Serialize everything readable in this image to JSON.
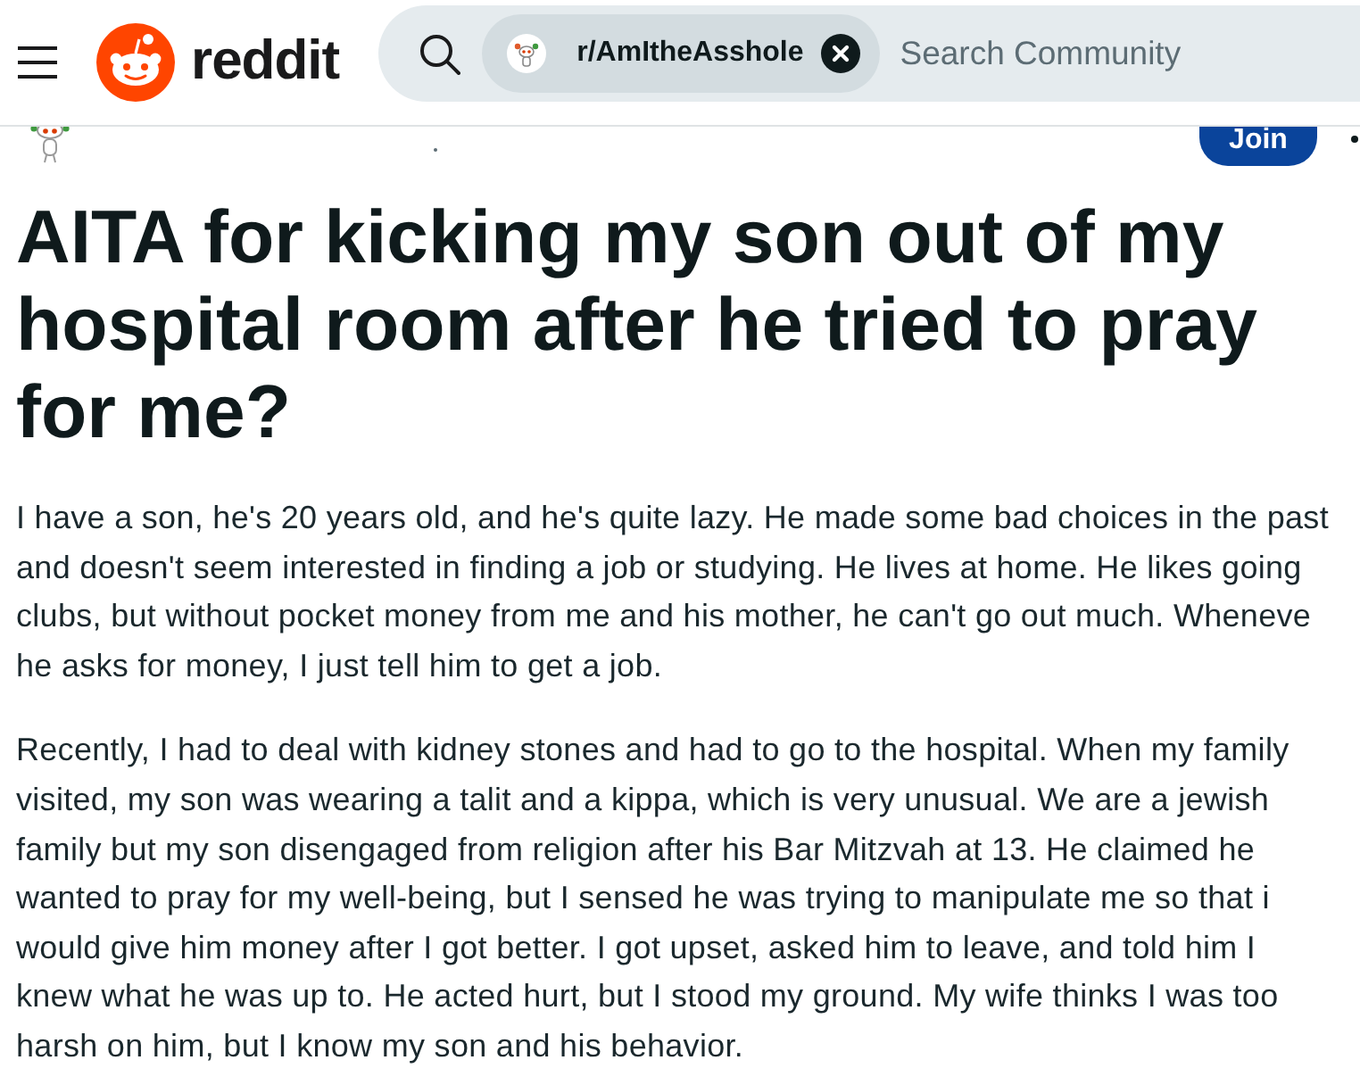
{
  "header": {
    "logo_text": "reddit",
    "search": {
      "community_chip": "r/AmItheAsshole",
      "placeholder": "Search Community"
    }
  },
  "subreddit_bar": {
    "join_button": "Join"
  },
  "post": {
    "title": "AITA for kicking my son out of my hospital room after he tried to pray for me?",
    "paragraphs": [
      {
        "lines": [
          "I have a son, he's 20 years old, and he's quite lazy. He made some bad choices in the past",
          "and doesn't seem interested in finding a job or studying. He lives at home. He likes going",
          "clubs, but without pocket money from me and his mother, he can't go out much. Wheneve",
          "he asks for money, I just tell him to get a job."
        ]
      },
      {
        "lines": [
          "Recently, I had to deal with kidney stones and had to go to the hospital. When my family",
          "visited, my son was wearing a talit and a kippa, which is very unusual. We are a jewish",
          "family but my son disengaged from religion after his Bar Mitzvah at 13. He claimed he",
          "wanted to pray for my well-being, but I sensed he was trying to manipulate me so that i",
          "would give him money after I got better. I got upset, asked him to leave, and told him I",
          "knew what he was up to. He acted hurt, but I stood my ground. My wife thinks I was too",
          "harsh on him, but I know my son and his behavior."
        ]
      }
    ]
  }
}
